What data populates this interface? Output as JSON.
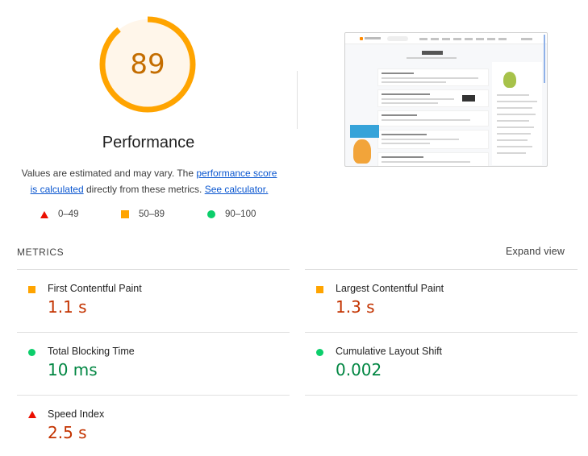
{
  "score": {
    "value": "89",
    "fraction": 0.89,
    "ring_color": "#ffa400",
    "text_color": "#c46d00",
    "bg_color": "#fff6ea"
  },
  "category_title": "Performance",
  "description": {
    "prefix": "Values are estimated and may vary. The ",
    "link1": "performance score is calculated",
    "middle": " directly from these metrics. ",
    "link2": "See calculator."
  },
  "legend": [
    {
      "icon": "fail-triangle-icon",
      "range": "0–49",
      "color": "#eb0f00"
    },
    {
      "icon": "average-square-icon",
      "range": "50–89",
      "color": "#ffa400"
    },
    {
      "icon": "pass-circle-icon",
      "range": "90–100",
      "color": "#0cce6b"
    }
  ],
  "metrics_header": "METRICS",
  "expand_label": "Expand view",
  "metrics": [
    {
      "name": "First Contentful Paint",
      "value": "1.1 s",
      "status": "average"
    },
    {
      "name": "Largest Contentful Paint",
      "value": "1.3 s",
      "status": "average"
    },
    {
      "name": "Total Blocking Time",
      "value": "10 ms",
      "status": "pass"
    },
    {
      "name": "Cumulative Layout Shift",
      "value": "0.002",
      "status": "pass"
    },
    {
      "name": "Speed Index",
      "value": "2.5 s",
      "status": "fail"
    }
  ]
}
